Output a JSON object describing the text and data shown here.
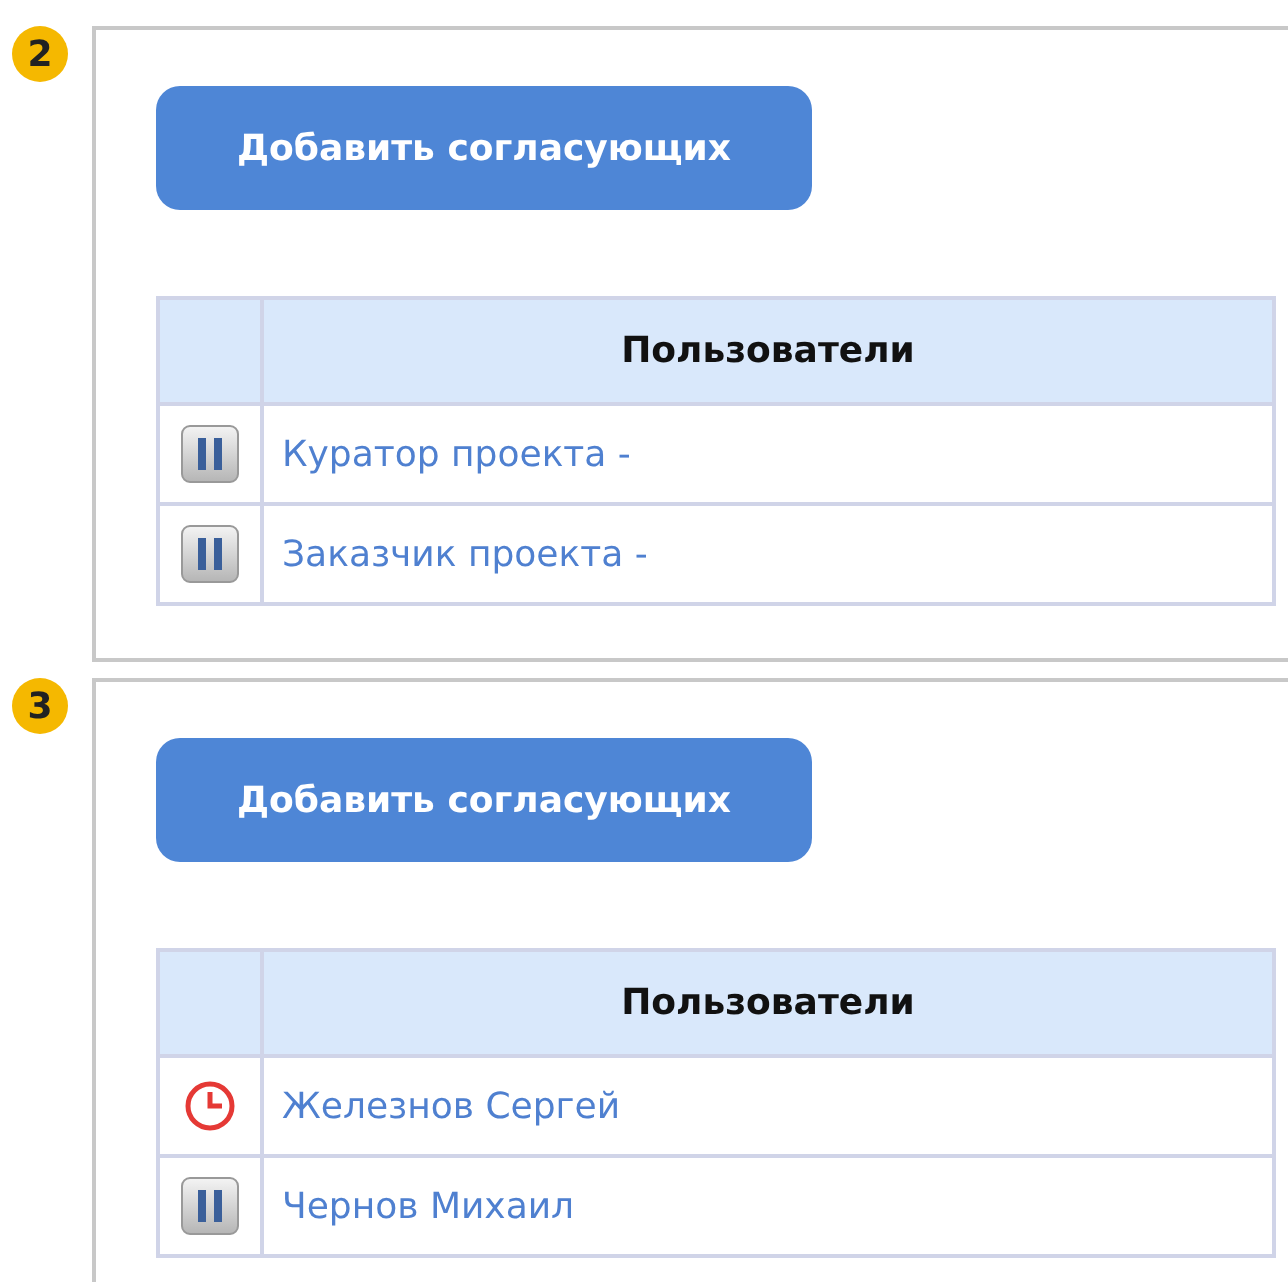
{
  "panels": [
    {
      "step": "2",
      "button": "Добавить согласующих",
      "table": {
        "columns": [
          "Пользователи"
        ],
        "rows": [
          {
            "kind": "paused",
            "user": "Куратор проекта -"
          },
          {
            "kind": "paused",
            "user": "Заказчик проекта -"
          }
        ]
      }
    },
    {
      "step": "3",
      "button": "Добавить согласующих",
      "table": {
        "columns": [
          "Пользователи"
        ],
        "rows": [
          {
            "kind": "pending",
            "user": "Железнов Сергей"
          },
          {
            "kind": "paused",
            "user": "Чернов Михаил"
          }
        ]
      }
    }
  ]
}
